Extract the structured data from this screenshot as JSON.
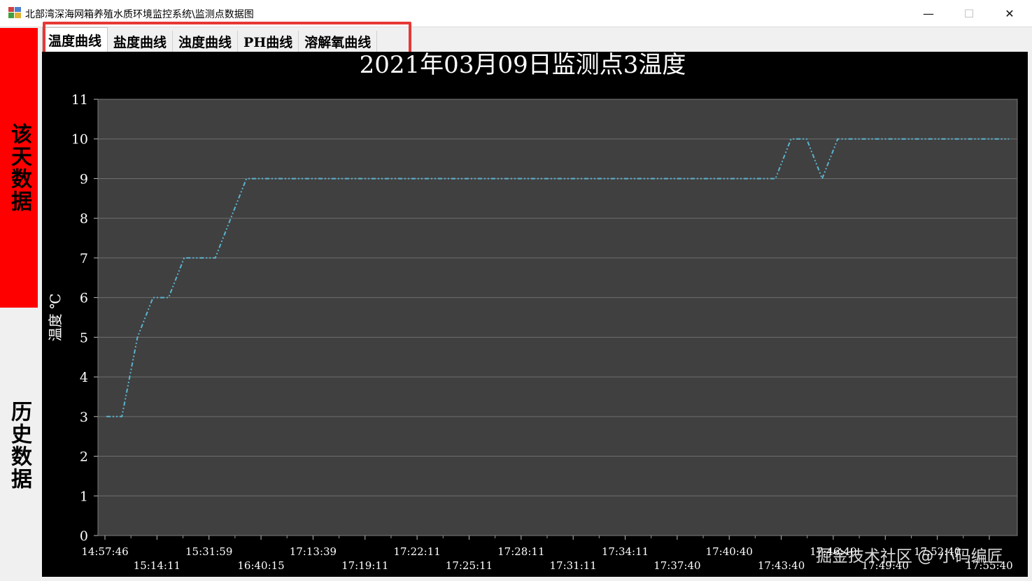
{
  "window": {
    "title": "北部湾深海网箱养殖水质环境监控系统\\监测点数据图",
    "minimize_label": "—",
    "maximize_label": "☐",
    "close_label": "✕"
  },
  "sidebar": {
    "today_label": "该天数据",
    "history_label": "历史数据",
    "today_color": "#ff0000"
  },
  "tabs": [
    {
      "label": "温度曲线",
      "active": true
    },
    {
      "label": "盐度曲线",
      "active": false
    },
    {
      "label": "浊度曲线",
      "active": false
    },
    {
      "label": "PH曲线",
      "active": false
    },
    {
      "label": "溶解氧曲线",
      "active": false
    }
  ],
  "chart_data": {
    "type": "line",
    "title": "2021年03月09日监测点3温度",
    "ylabel": "温度 ℃",
    "xlabel": "",
    "ylim": [
      0,
      11
    ],
    "yticks": [
      0,
      1,
      2,
      3,
      4,
      5,
      6,
      7,
      8,
      9,
      10,
      11
    ],
    "grid": true,
    "line_color": "#5ab4d0",
    "x_labels": [
      "14:57:46",
      "15:14:11",
      "15:31:59",
      "16:40:15",
      "17:13:39",
      "17:19:11",
      "17:22:11",
      "17:25:11",
      "17:28:11",
      "17:31:11",
      "17:34:11",
      "17:37:40",
      "17:40:40",
      "17:43:40",
      "17:46:40",
      "17:49:40",
      "17:52:40",
      "17:55:40"
    ],
    "series": [
      {
        "values": [
          3,
          3,
          5,
          6,
          6,
          7,
          7,
          7,
          8,
          9,
          9,
          9,
          9,
          9,
          9,
          9,
          9,
          9,
          9,
          9,
          9,
          9,
          9,
          9,
          9,
          9,
          9,
          9,
          9,
          9,
          9,
          9,
          9,
          9,
          9,
          9,
          9,
          9,
          9,
          9,
          9,
          9,
          9,
          9,
          10,
          10,
          9,
          10,
          10,
          10,
          10,
          10,
          10,
          10,
          10,
          10,
          10,
          10,
          10
        ]
      }
    ]
  },
  "watermark": "掘金技术社区 @ 小码编匠"
}
